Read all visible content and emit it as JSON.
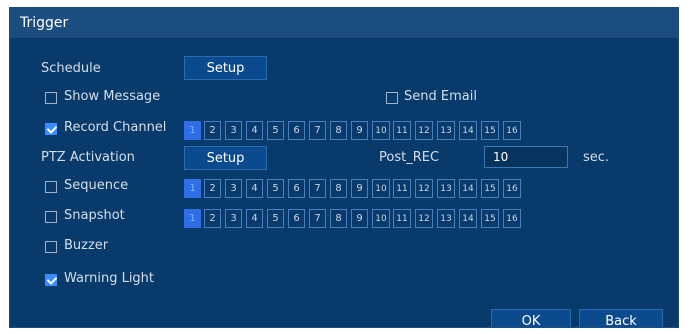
{
  "dialog": {
    "title": "Trigger"
  },
  "schedule": {
    "label": "Schedule",
    "button": "Setup"
  },
  "show_message": {
    "label": "Show Message",
    "checked": false
  },
  "send_email": {
    "label": "Send Email",
    "checked": false
  },
  "record_channel": {
    "label": "Record Channel",
    "checked": true,
    "channels": [
      "1",
      "2",
      "3",
      "4",
      "5",
      "6",
      "7",
      "8",
      "9",
      "10",
      "11",
      "12",
      "13",
      "14",
      "15",
      "16"
    ],
    "selected": [
      "1"
    ]
  },
  "ptz": {
    "label": "PTZ Activation",
    "button": "Setup"
  },
  "post_rec": {
    "label": "Post_REC",
    "value": "10",
    "unit": "sec."
  },
  "sequence": {
    "label": "Sequence",
    "checked": false,
    "channels": [
      "1",
      "2",
      "3",
      "4",
      "5",
      "6",
      "7",
      "8",
      "9",
      "10",
      "11",
      "12",
      "13",
      "14",
      "15",
      "16"
    ],
    "selected": [
      "1"
    ]
  },
  "snapshot": {
    "label": "Snapshot",
    "checked": false,
    "channels": [
      "1",
      "2",
      "3",
      "4",
      "5",
      "6",
      "7",
      "8",
      "9",
      "10",
      "11",
      "12",
      "13",
      "14",
      "15",
      "16"
    ],
    "selected": [
      "1"
    ]
  },
  "buzzer": {
    "label": "Buzzer",
    "checked": false
  },
  "warning_light": {
    "label": "Warning Light",
    "checked": true
  },
  "footer": {
    "ok": "OK",
    "back": "Back"
  },
  "colors": {
    "background": "#083a6b",
    "titlebar": "#1b4d80",
    "accent": "#3a8dff",
    "selected_channel": "#2e6fe6"
  }
}
